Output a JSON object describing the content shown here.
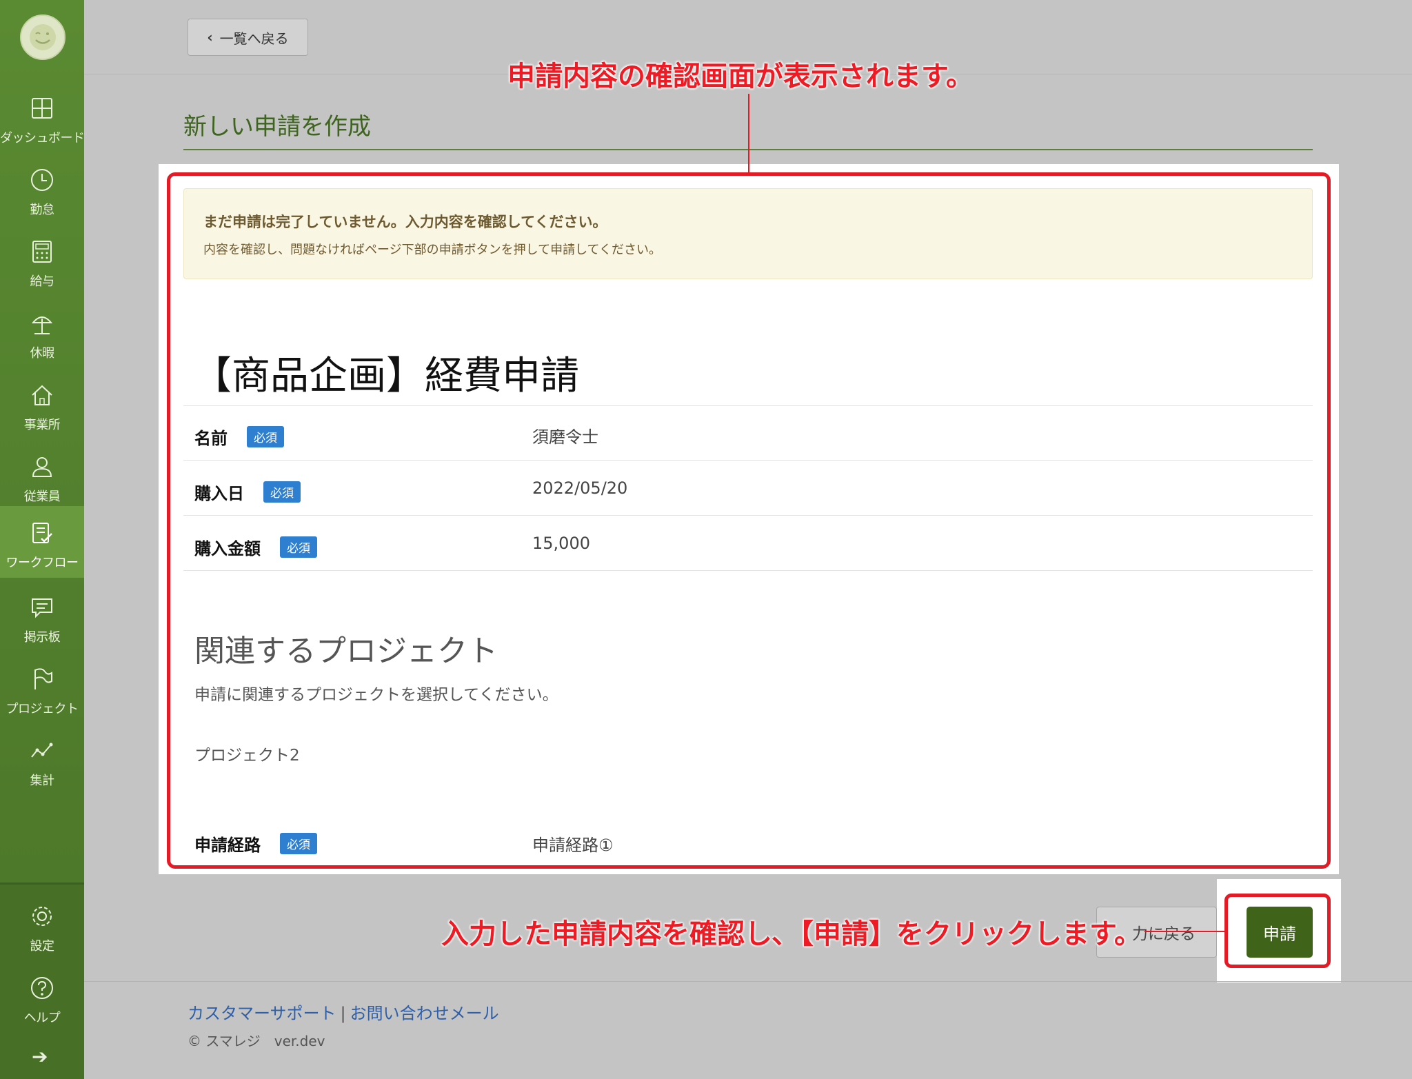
{
  "sidebar": {
    "items": [
      {
        "label": "ダッシュボード",
        "icon": "dashboard-icon"
      },
      {
        "label": "勤怠",
        "icon": "clock-icon"
      },
      {
        "label": "給与",
        "icon": "calculator-icon"
      },
      {
        "label": "休暇",
        "icon": "beach-umbrella-icon"
      },
      {
        "label": "事業所",
        "icon": "home-icon"
      },
      {
        "label": "従業員",
        "icon": "person-icon"
      },
      {
        "label": "ワークフロー",
        "icon": "workflow-icon",
        "active": true
      },
      {
        "label": "掲示板",
        "icon": "message-board-icon"
      },
      {
        "label": "プロジェクト",
        "icon": "flag-icon"
      },
      {
        "label": "集計",
        "icon": "line-chart-icon"
      }
    ],
    "bottom_items": [
      {
        "label": "設定",
        "icon": "gear-icon"
      },
      {
        "label": "ヘルプ",
        "icon": "help-icon"
      }
    ]
  },
  "topbar": {
    "back_label": "一覧へ戻る"
  },
  "page": {
    "title": "新しい申請を作成"
  },
  "notice": {
    "title": "まだ申請は完了していません。入力内容を確認してください。",
    "body": "内容を確認し、問題なければページ下部の申請ボタンを押して申請してください。"
  },
  "form": {
    "title": "【商品企画】経費申請",
    "required_badge": "必須",
    "fields": [
      {
        "label": "名前",
        "value": "須磨令士"
      },
      {
        "label": "購入日",
        "value": "2022/05/20"
      },
      {
        "label": "購入金額",
        "value": "15,000"
      }
    ],
    "project_section": {
      "heading": "関連するプロジェクト",
      "description": "申請に関連するプロジェクトを選択してください。",
      "value": "プロジェクト2"
    },
    "route": {
      "label": "申請経路",
      "value": "申請経路①"
    }
  },
  "actions": {
    "back_to_input_label": "力に戻る",
    "submit_label": "申請"
  },
  "footer": {
    "support_link": "カスタマーサポート",
    "separator": "|",
    "mail_link": "お問い合わせメール",
    "copyright": "© スマレジ　ver.dev"
  },
  "annotations": {
    "top": "申請内容の確認画面が表示されます。",
    "bottom": "入力した申請内容を確認し､【申請】をクリックします。"
  },
  "colors": {
    "sidebar": "#4f7d2c",
    "accent": "#3f6419",
    "highlight": "#e21b26",
    "badge": "#2f7fd0"
  }
}
